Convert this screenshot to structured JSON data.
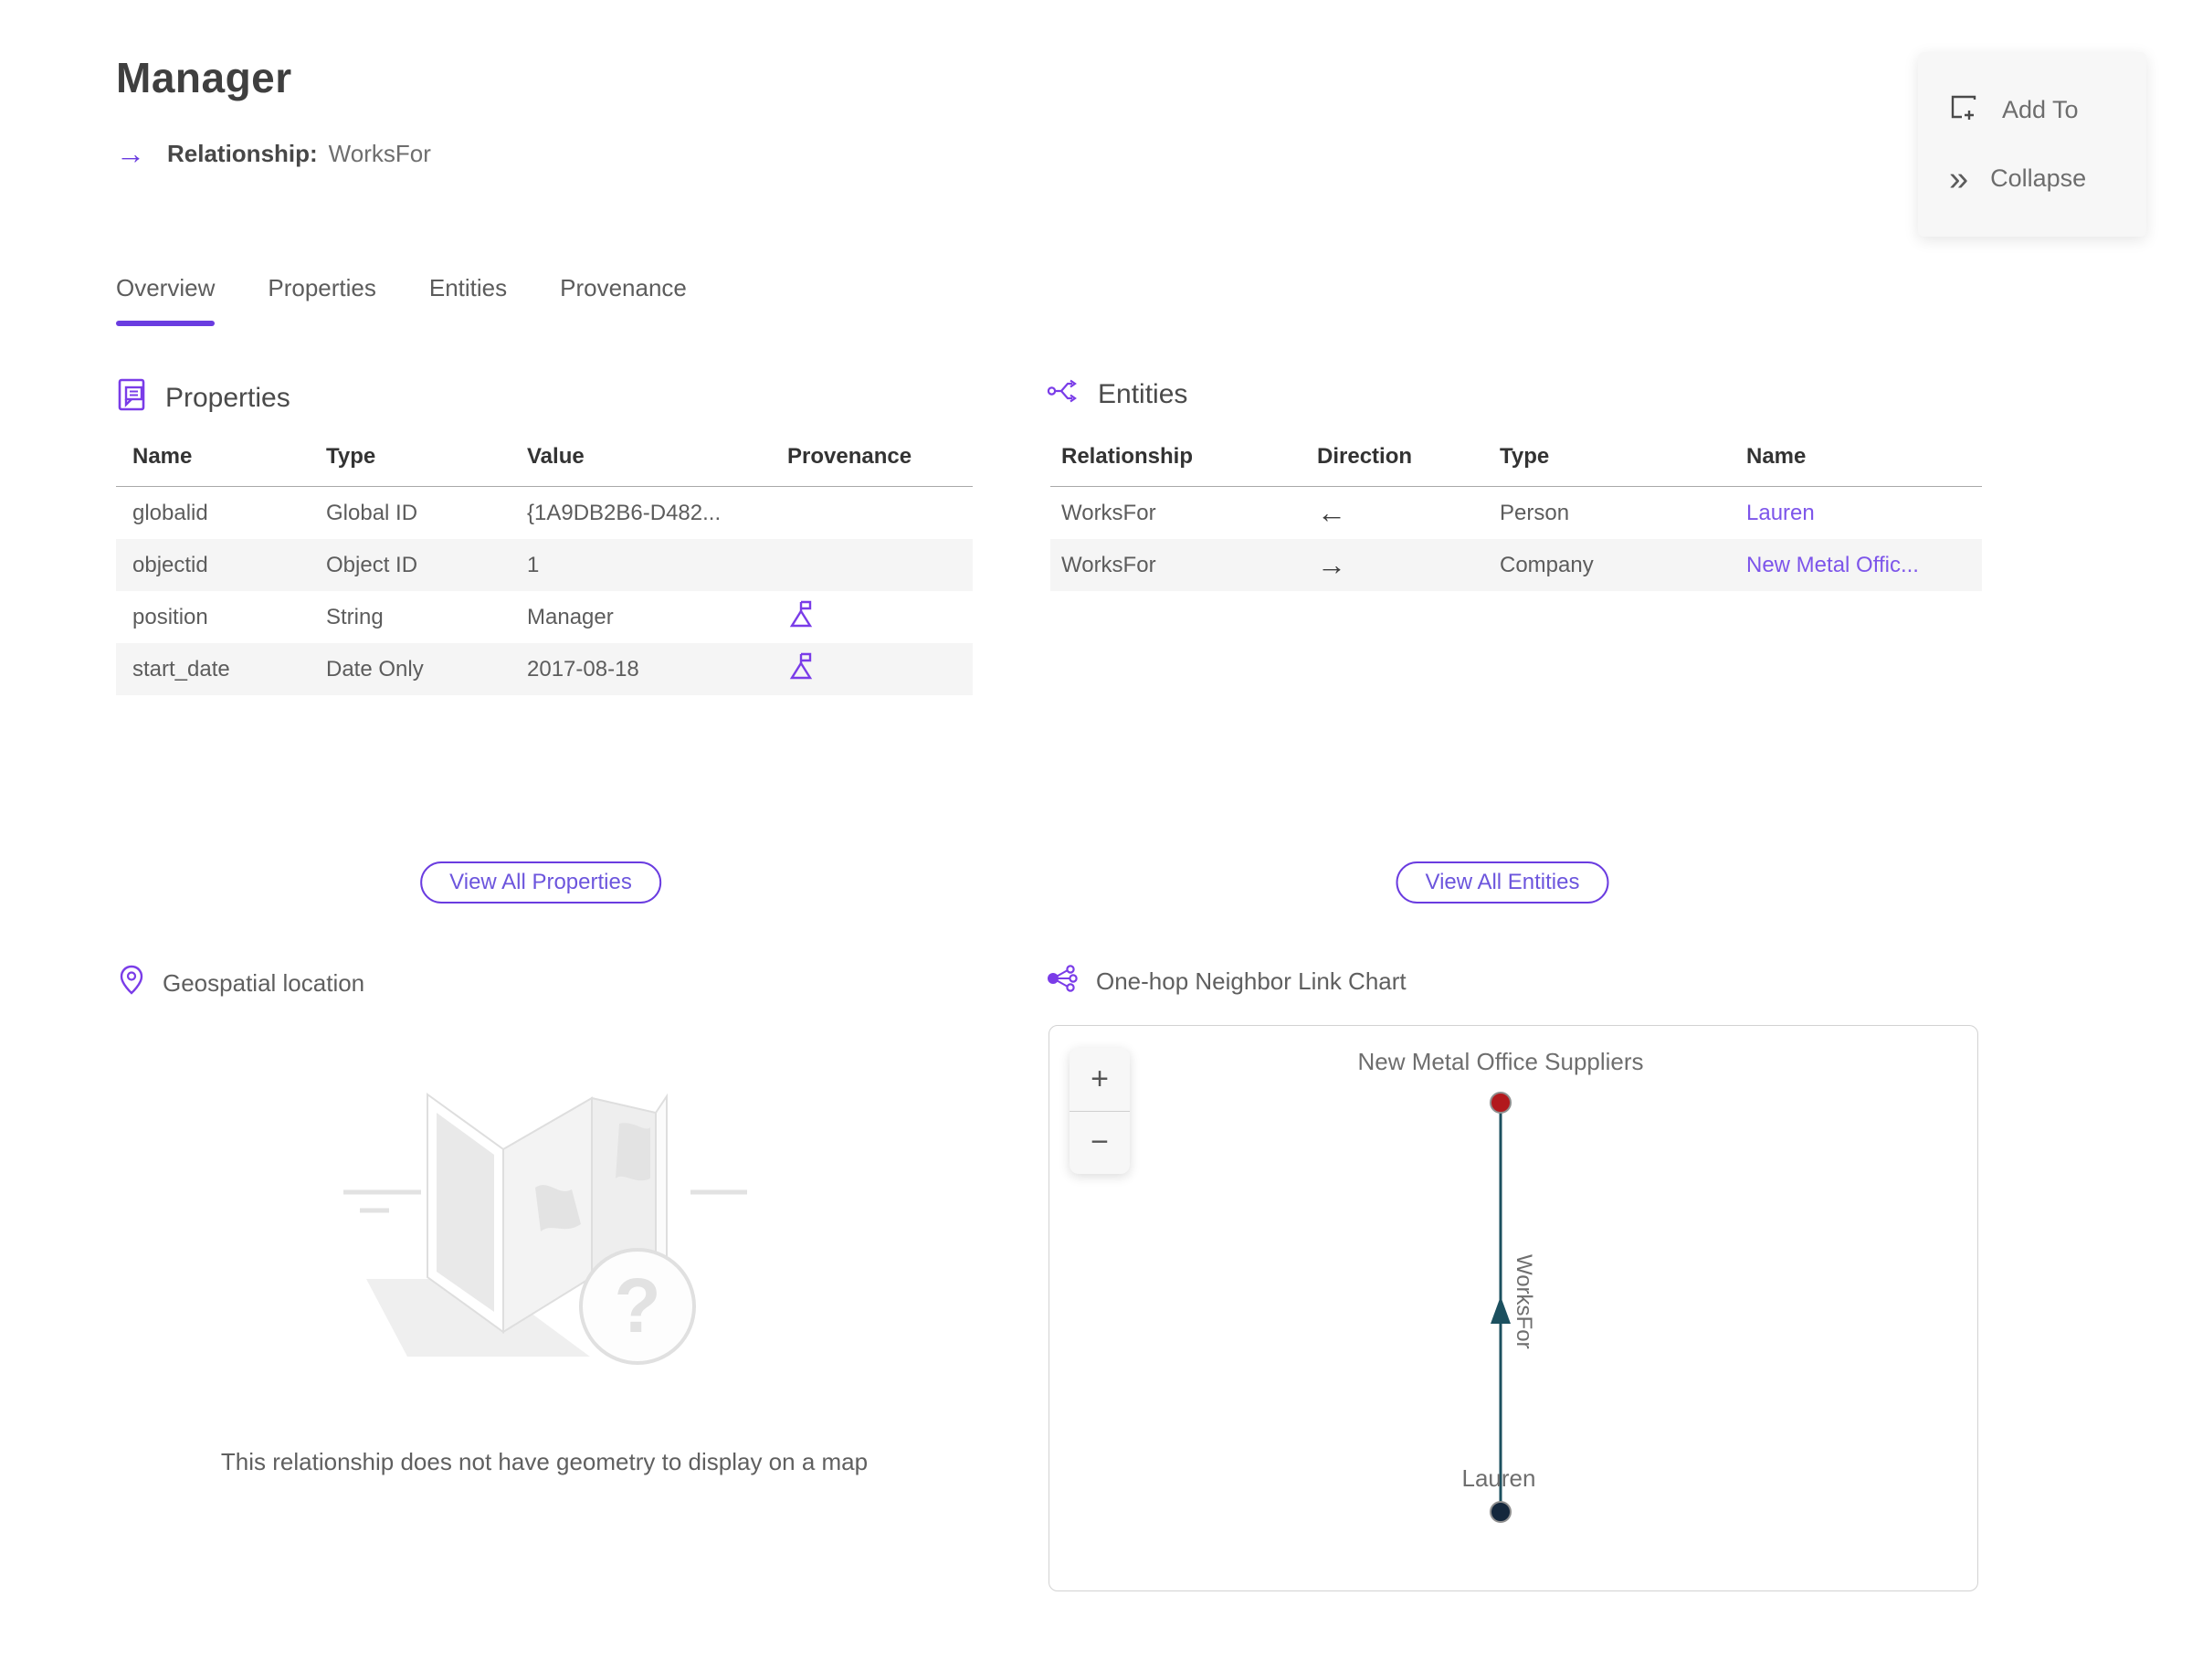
{
  "colors": {
    "accent": "#6a3ce0",
    "link": "#7d55ea",
    "node_company": "#b2191d",
    "node_person": "#14273c",
    "edge": "#1c505f"
  },
  "header": {
    "title": "Manager",
    "relationship_label": "Relationship:",
    "relationship_value": "WorksFor",
    "arrow_glyph": "→"
  },
  "actions": {
    "add_to_label": "Add To",
    "collapse_label": "Collapse",
    "collapse_glyph": "»",
    "icons": {
      "add_to": "add-to-window-icon",
      "collapse": "double-chevron-right-icon"
    }
  },
  "tabs": [
    {
      "label": "Overview",
      "active": true
    },
    {
      "label": "Properties",
      "active": false
    },
    {
      "label": "Entities",
      "active": false
    },
    {
      "label": "Provenance",
      "active": false
    }
  ],
  "properties": {
    "section_title": "Properties",
    "icon": "document-note-icon",
    "columns": [
      "Name",
      "Type",
      "Value",
      "Provenance"
    ],
    "rows": [
      {
        "name": "globalid",
        "type": "Global ID",
        "value": "{1A9DB2B6-D482...",
        "provenance": false
      },
      {
        "name": "objectid",
        "type": "Object ID",
        "value": "1",
        "provenance": false
      },
      {
        "name": "position",
        "type": "String",
        "value": "Manager",
        "provenance": true
      },
      {
        "name": "start_date",
        "type": "Date Only",
        "value": "2017-08-18",
        "provenance": true
      }
    ],
    "provenance_icon": "flag-summit-icon",
    "view_all_label": "View All Properties"
  },
  "entities": {
    "section_title": "Entities",
    "icon": "branch-arrows-icon",
    "columns": [
      "Relationship",
      "Direction",
      "Type",
      "Name"
    ],
    "rows": [
      {
        "relationship": "WorksFor",
        "direction": "←",
        "type": "Person",
        "name": "Lauren"
      },
      {
        "relationship": "WorksFor",
        "direction": "→",
        "type": "Company",
        "name": "New Metal Offic..."
      }
    ],
    "view_all_label": "View All Entities"
  },
  "geospatial": {
    "section_title": "Geospatial location",
    "icon": "map-pin-icon",
    "empty_message": "This relationship does not have geometry to display on a map",
    "placeholder_glyph": "?"
  },
  "link_chart": {
    "section_title": "One-hop Neighbor Link Chart",
    "icon": "share-nodes-icon",
    "zoom_in_label": "+",
    "zoom_out_label": "−",
    "nodes": [
      {
        "label": "New Metal Office Suppliers",
        "color": "#b2191d"
      },
      {
        "label": "Lauren",
        "color": "#14273c"
      }
    ],
    "edge": {
      "label": "WorksFor",
      "color": "#1c505f"
    }
  }
}
